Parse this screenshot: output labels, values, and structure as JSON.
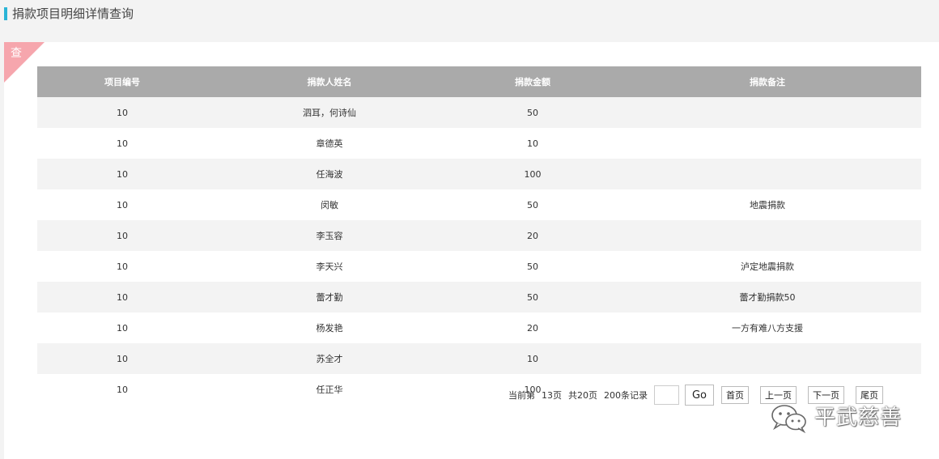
{
  "header": {
    "title": "捐款项目明细详情查询"
  },
  "panel": {
    "corner_label": "查"
  },
  "table": {
    "columns": [
      "项目编号",
      "捐款人姓名",
      "捐款金额",
      "捐款备注"
    ],
    "rows": [
      [
        "10",
        "泗耳，何诗仙",
        "50",
        ""
      ],
      [
        "10",
        "章德英",
        "10",
        ""
      ],
      [
        "10",
        "任海波",
        "100",
        ""
      ],
      [
        "10",
        "闵敏",
        "50",
        "地震捐款"
      ],
      [
        "10",
        "李玉容",
        "20",
        ""
      ],
      [
        "10",
        "李天兴",
        "50",
        "泸定地震捐款"
      ],
      [
        "10",
        "蕾才勤",
        "50",
        "蕾才勤捐款50"
      ],
      [
        "10",
        "杨发艳",
        "20",
        "一方有难八方支援"
      ],
      [
        "10",
        "苏全才",
        "10",
        ""
      ],
      [
        "10",
        "任正华",
        "100",
        ""
      ]
    ]
  },
  "pagination": {
    "current_label": "当前第",
    "current_page": "13页",
    "total_pages": "共20页",
    "total_records": "200条记录",
    "page_input_value": "",
    "go_label": "Go",
    "first_label": "首页",
    "prev_label": "上一页",
    "next_label": "下一页",
    "last_label": "尾页"
  },
  "watermark": {
    "text": "平武慈善",
    "icon": "wechat-icon"
  },
  "colors": {
    "accent": "#2ab4d6",
    "table_header": "#aaaaaa",
    "corner_tag": "#f6a6ad"
  }
}
